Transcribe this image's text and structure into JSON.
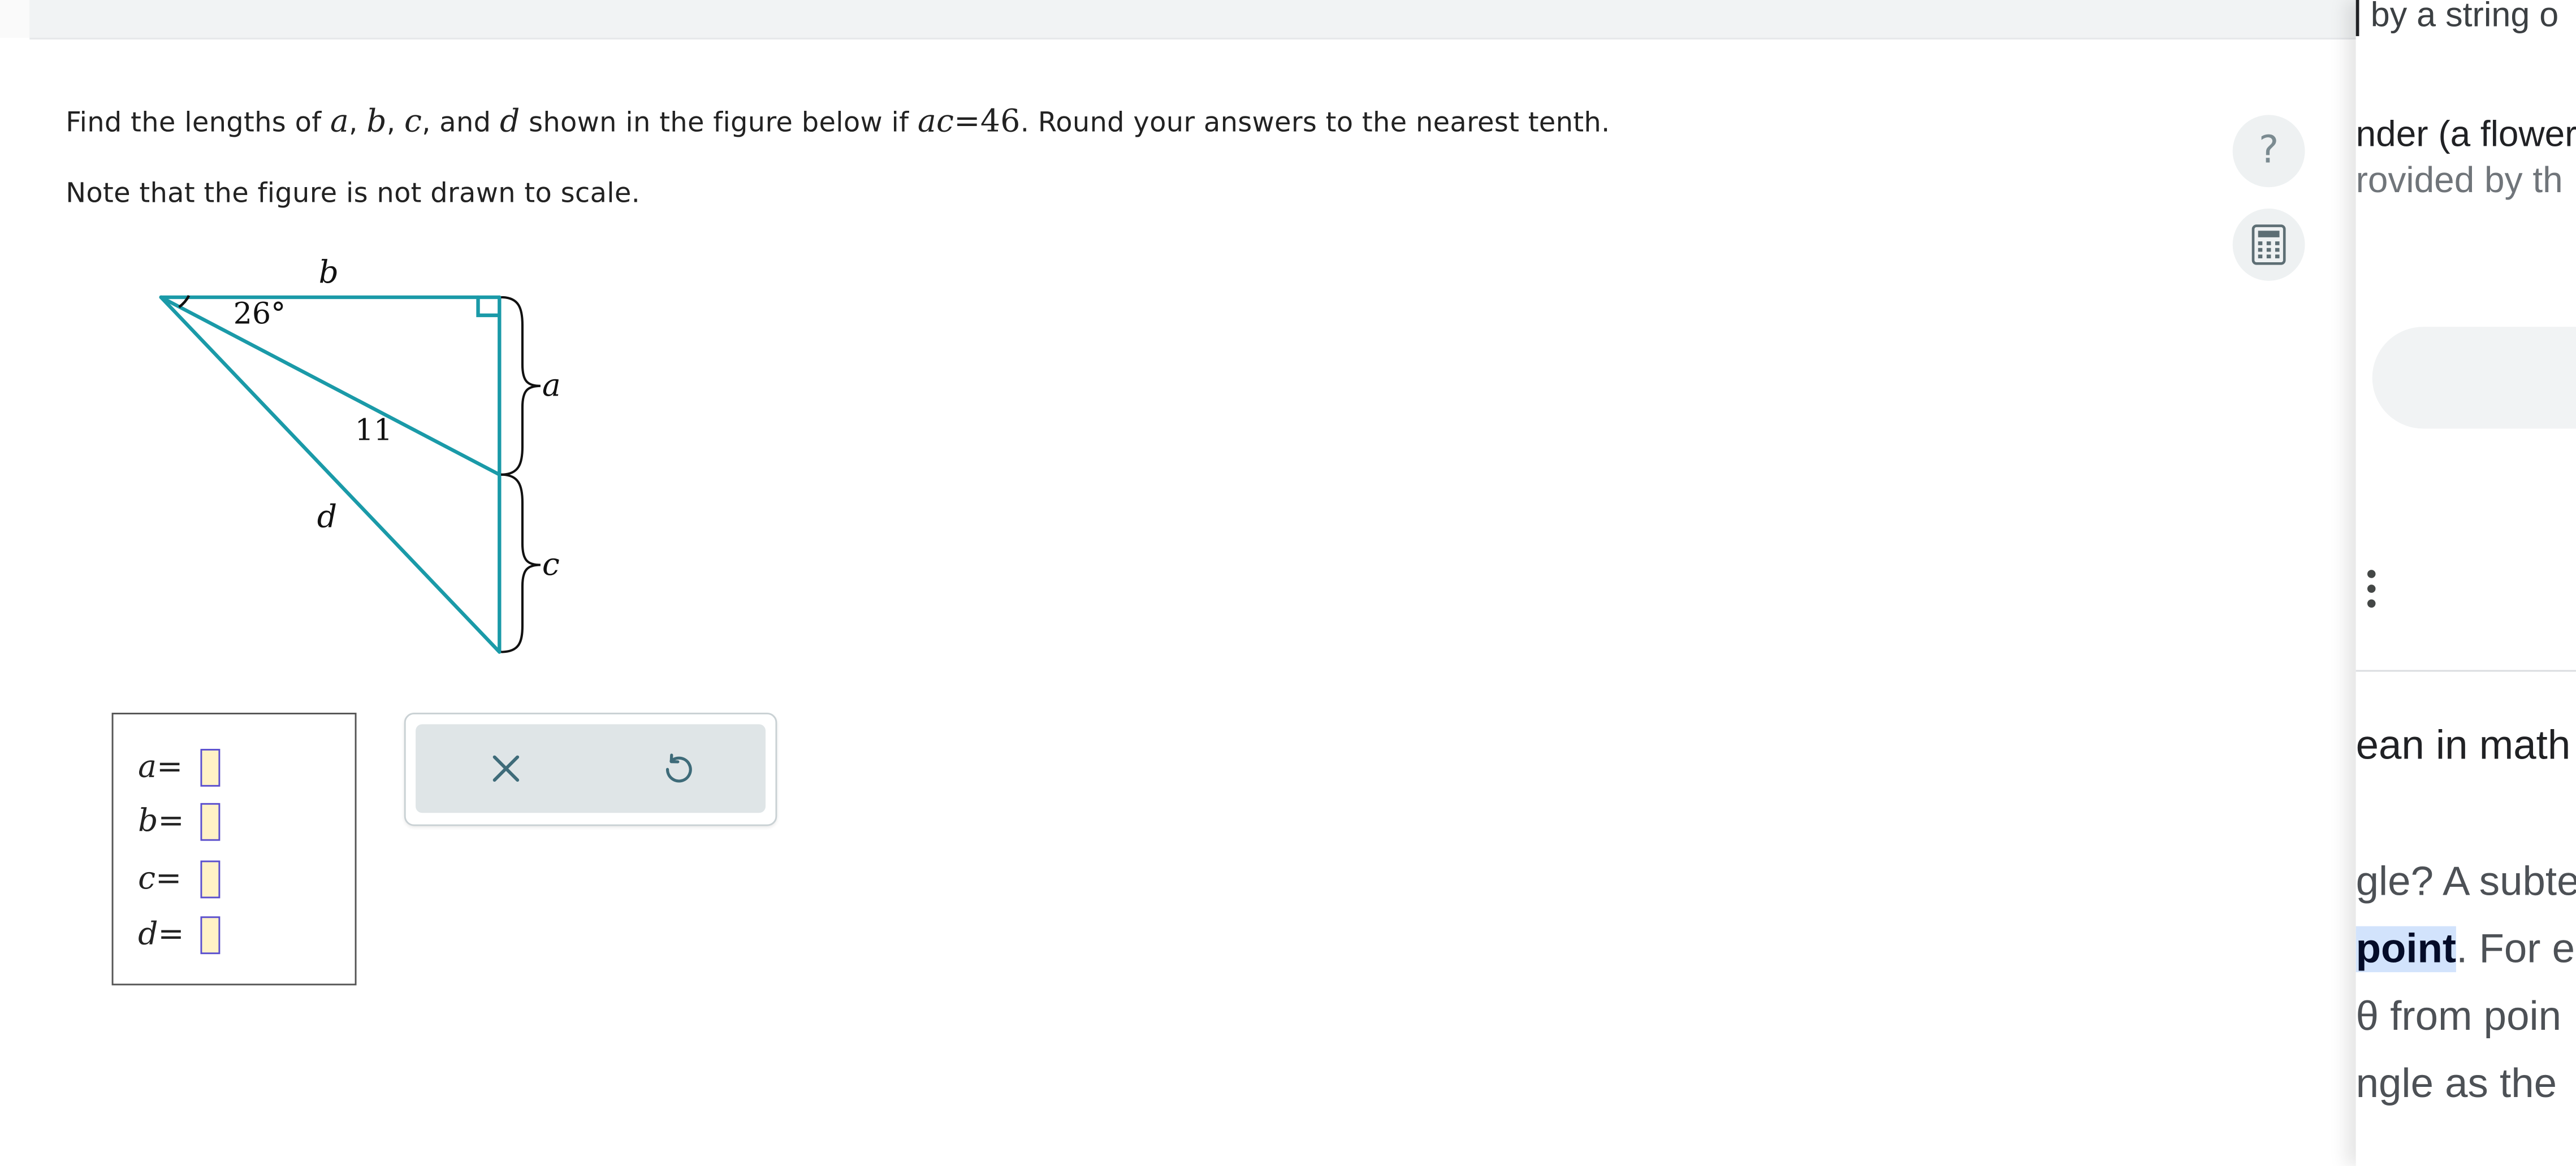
{
  "problem": {
    "line1": {
      "text_a": "Find the lengths of ",
      "var_a": "a",
      "sep_1": ", ",
      "var_b": "b",
      "sep_2": ", ",
      "var_c": "c",
      "sep_3": ", and ",
      "var_d": "d",
      "text_b": " shown in the figure below if ",
      "given_lhs": "ac",
      "given_eq": "=",
      "given_value": "46",
      "text_c": ". Round your answers to the nearest tenth."
    },
    "line2": "Note that the figure is not drawn to scale."
  },
  "figure": {
    "label_b": "b",
    "label_angle": "26°",
    "label_a": "a",
    "label_hyp": "11",
    "label_d": "d",
    "label_c": "c",
    "stroke_color": "#1a9aa8"
  },
  "answers": [
    {
      "var": "a",
      "eq": "=",
      "value": ""
    },
    {
      "var": "b",
      "eq": "=",
      "value": ""
    },
    {
      "var": "c",
      "eq": "=",
      "value": ""
    },
    {
      "var": "d",
      "eq": "=",
      "value": ""
    }
  ],
  "tools": {
    "clear_icon": "close-icon",
    "undo_icon": "undo-icon"
  },
  "side_buttons": {
    "help_label": "?",
    "help_icon": "help-icon",
    "calculator_icon": "calculator-icon"
  },
  "right_panel": {
    "line1": "by a string o",
    "line2": "nder (a flower",
    "line3": "rovided by th",
    "line4": "ean in math",
    "line5": "gle? A subte",
    "line6_highlight": "point",
    "line6_rest": ". For e",
    "line7": "θ from poin",
    "line8": "ngle as the"
  }
}
